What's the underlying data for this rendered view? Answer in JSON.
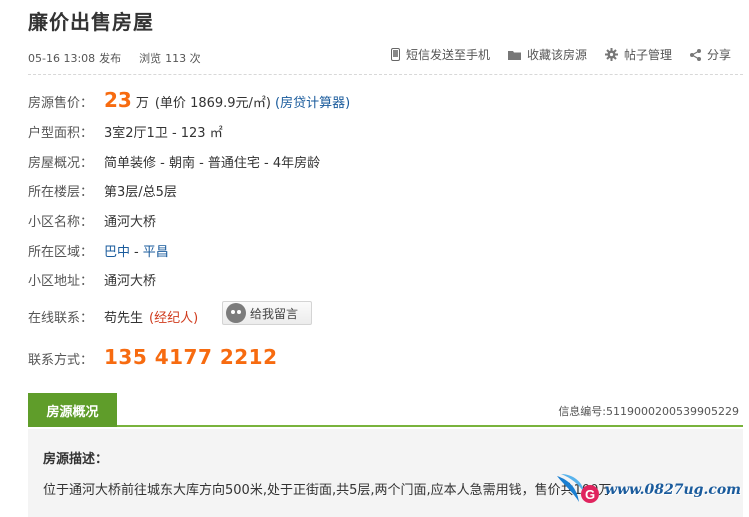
{
  "title": "廉价出售房屋",
  "meta": {
    "datetime": "05-16 13:08",
    "published": "发布",
    "views_label": "浏览",
    "views_count": "113 次"
  },
  "actions": {
    "sms": "短信发送至手机",
    "favorite": "收藏该房源",
    "manage": "帖子管理",
    "share": "分享"
  },
  "details": {
    "price_label": "房源售价：",
    "price_value": "23",
    "price_unit": "万",
    "unit_price": "(单价  1869.9元/㎡)",
    "calculator": "(房贷计算器)",
    "type_label": "户型面积：",
    "type_value": "3室2厅1卫  - 123 ㎡",
    "overview_label": "房屋概况：",
    "overview_value": "简单装修 - 朝南 - 普通住宅 - 4年房龄",
    "floor_label": "所在楼层：",
    "floor_value": "第3层/总5层",
    "community_label": "小区名称：",
    "community_value": "通河大桥",
    "district_label": "所在区域：",
    "district_1": "巴中",
    "district_sep": "-",
    "district_2": "平昌",
    "address_label": "小区地址：",
    "address_value": "通河大桥",
    "online_label": "在线联系：",
    "contact_name": "苟先生",
    "contact_role": "(经纪人)",
    "message_button": "给我留言",
    "phone_label": "联系方式：",
    "phone_value": "135 4177 2212"
  },
  "section": {
    "tab": "房源概况",
    "info_number": "信息编号:5119000200539905229"
  },
  "description": {
    "title": "房源描述：",
    "text": "位于通河大桥前往城东大库方向500米,处于正街面,共5层,两个门面,应本人急需用钱，售价共100万"
  },
  "watermark": {
    "site": "www.0827ug.com"
  },
  "colors": {
    "accent_orange": "#f76b10",
    "link_blue": "#1a5b9c",
    "tab_green": "#5f9d2a",
    "agent_red": "#d03c1e"
  }
}
